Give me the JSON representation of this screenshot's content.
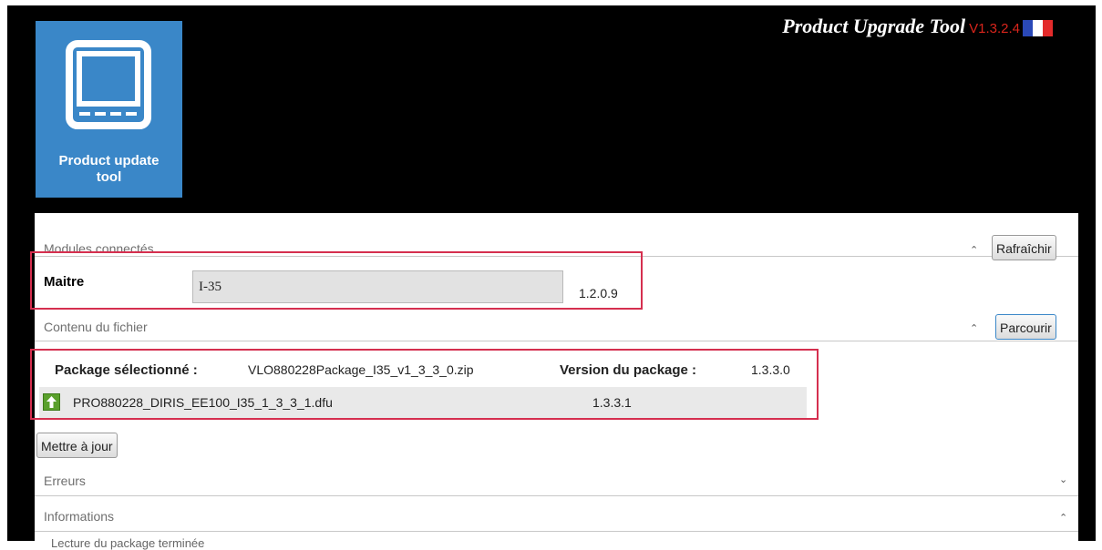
{
  "app": {
    "title": "Product Upgrade Tool",
    "version": "V1.3.2.4",
    "tile_label_line1": "Product update",
    "tile_label_line2": "tool",
    "language_flag": "french-flag-icon"
  },
  "modules": {
    "section_title": "Modules connectés",
    "refresh_button": "Rafraîchir",
    "master_label": "Maitre",
    "master_value": "I-35",
    "master_version": "1.2.0.9"
  },
  "file_contents": {
    "section_title": "Contenu du fichier",
    "browse_button": "Parcourir",
    "selected_package_label": "Package sélectionné :",
    "selected_package_value": "VLO880228Package_I35_v1_3_3_0.zip",
    "package_version_label": "Version du package :",
    "package_version_value": "1.3.3.0",
    "file_name": "PRO880228_DIRIS_EE100_I35_1_3_3_1.dfu",
    "file_version": "1.3.3.1"
  },
  "actions": {
    "update_button": "Mettre à jour"
  },
  "errors": {
    "section_title": "Erreurs"
  },
  "informations": {
    "section_title": "Informations",
    "first_line": "Lecture du package terminée"
  },
  "colors": {
    "tile": "#3a87c8",
    "version_red": "#d9251c",
    "highlight_box": "#d52f4f"
  }
}
